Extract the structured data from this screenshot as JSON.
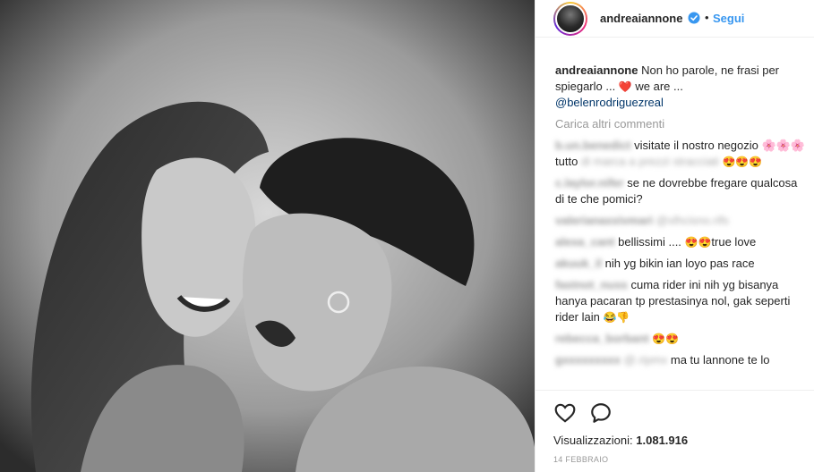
{
  "post": {
    "username": "andreaiannone",
    "follow_label": "Segui",
    "dot": "•"
  },
  "caption": {
    "username": "andreaiannone",
    "text": " Non ho parole, ne frasi per spiegarlo ... ",
    "heart": "❤️",
    "text2": " we are ...",
    "mention": "@belenrodriguezreal"
  },
  "load_more": "Carica altri commenti",
  "comments": [
    {
      "user": "b.un.benedict",
      "text": "visitate il nostro negozio 🌸🌸🌸 tutto",
      "blurred_tail": "di marca a prezzi stracciati",
      "emoji": "😍😍😍"
    },
    {
      "user": "c.laylor.nifer",
      "text": "se ne dovrebbe fregare qualcosa di te che pomici?"
    },
    {
      "user": "valerianaxxivmari",
      "text": "",
      "blurred_tail": "@xlhcisno.rifs"
    },
    {
      "user": "alexa_cant",
      "text": "bellissimi .... ",
      "emoji": "😍😍",
      "text2": "true love"
    },
    {
      "user": "akuuk_il",
      "text": "nih yg bikin ian loyo pas race"
    },
    {
      "user": "fastnot_nuss",
      "text": "cuma rider ini nih yg bisanya hanya pacaran tp prestasinya nol, gak seperti rider lain ",
      "emoji": "😂👎"
    },
    {
      "user": "rebecca_borbant",
      "text": "",
      "emoji": "😍😍"
    },
    {
      "user": "gxxxxxxxxx",
      "text": "ma tu lannone te lo",
      "blurred_tail": "@.ripmx"
    }
  ],
  "views": {
    "label": "Visualizzazioni:",
    "count": "1.081.916"
  },
  "date": "14 FEBBRAIO",
  "icons": {
    "like": "heart-icon",
    "comment": "comment-bubble-icon",
    "verified": "verified-badge-icon"
  },
  "colors": {
    "link": "#3897f0",
    "mention": "#003569",
    "verified": "#3897f0"
  }
}
